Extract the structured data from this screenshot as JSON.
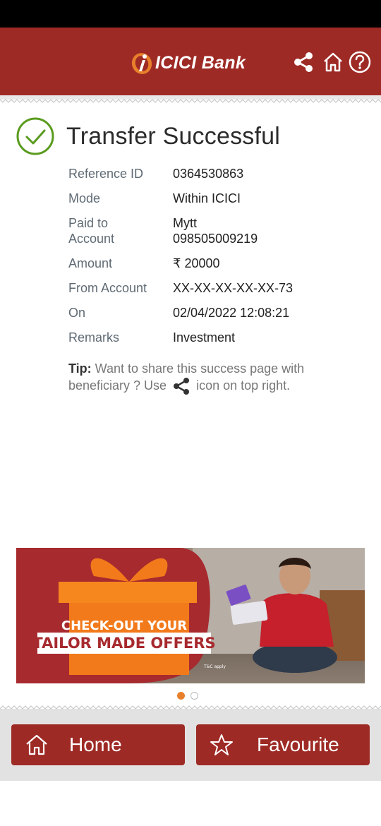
{
  "header": {
    "logo_text_a": "ICICI",
    "logo_text_b": " Bank",
    "icons": [
      "share-icon",
      "home-icon",
      "help-icon"
    ]
  },
  "status": {
    "title": "Transfer Successful",
    "icon": "check-circle-icon",
    "color": "#5a9b1e"
  },
  "details": [
    {
      "label": "Reference ID",
      "value": "0364530863"
    },
    {
      "label": "Mode",
      "value": "Within ICICI"
    },
    {
      "label": "Paid to Account",
      "value": "Mytt 098505009219"
    },
    {
      "label": "Amount",
      "value": "₹ 20000"
    },
    {
      "label": "From Account",
      "value": "XX-XX-XX-XX-XX-73"
    },
    {
      "label": "On",
      "value": "02/04/2022 12:08:21"
    },
    {
      "label": "Remarks",
      "value": "Investment"
    }
  ],
  "tip": {
    "label": "Tip:",
    "text_before": " Want to share this success page with beneficiary ? Use ",
    "text_after": " icon on top right."
  },
  "banner": {
    "line1": "CHECK-OUT YOUR",
    "line2": "TAILOR MADE OFFERS",
    "fine_print": "T&C apply",
    "slide_index": 1,
    "slide_count": 2
  },
  "bottom_nav": {
    "home_label": "Home",
    "favourite_label": "Favourite"
  },
  "colors": {
    "brand": "#9e2a25",
    "accent": "#e8802b"
  }
}
